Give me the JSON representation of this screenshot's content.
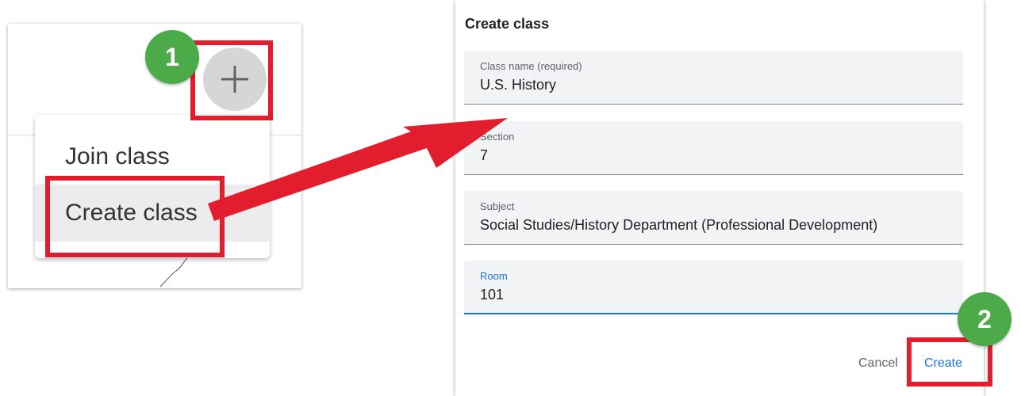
{
  "menu_panel": {
    "join_label": "Join class",
    "create_label": "Create class"
  },
  "dialog": {
    "title": "Create class",
    "fields": [
      {
        "label": "Class name (required)",
        "value": "U.S. History"
      },
      {
        "label": "Section",
        "value": "7"
      },
      {
        "label": "Subject",
        "value": "Social Studies/History Department (Professional Development)"
      },
      {
        "label": "Room",
        "value": "101"
      }
    ],
    "cancel_label": "Cancel",
    "create_label": "Create"
  },
  "steps": {
    "one": "1",
    "two": "2"
  },
  "colors": {
    "highlight": "#e21d2e",
    "badge": "#4caa48",
    "accent": "#1a73e8"
  }
}
